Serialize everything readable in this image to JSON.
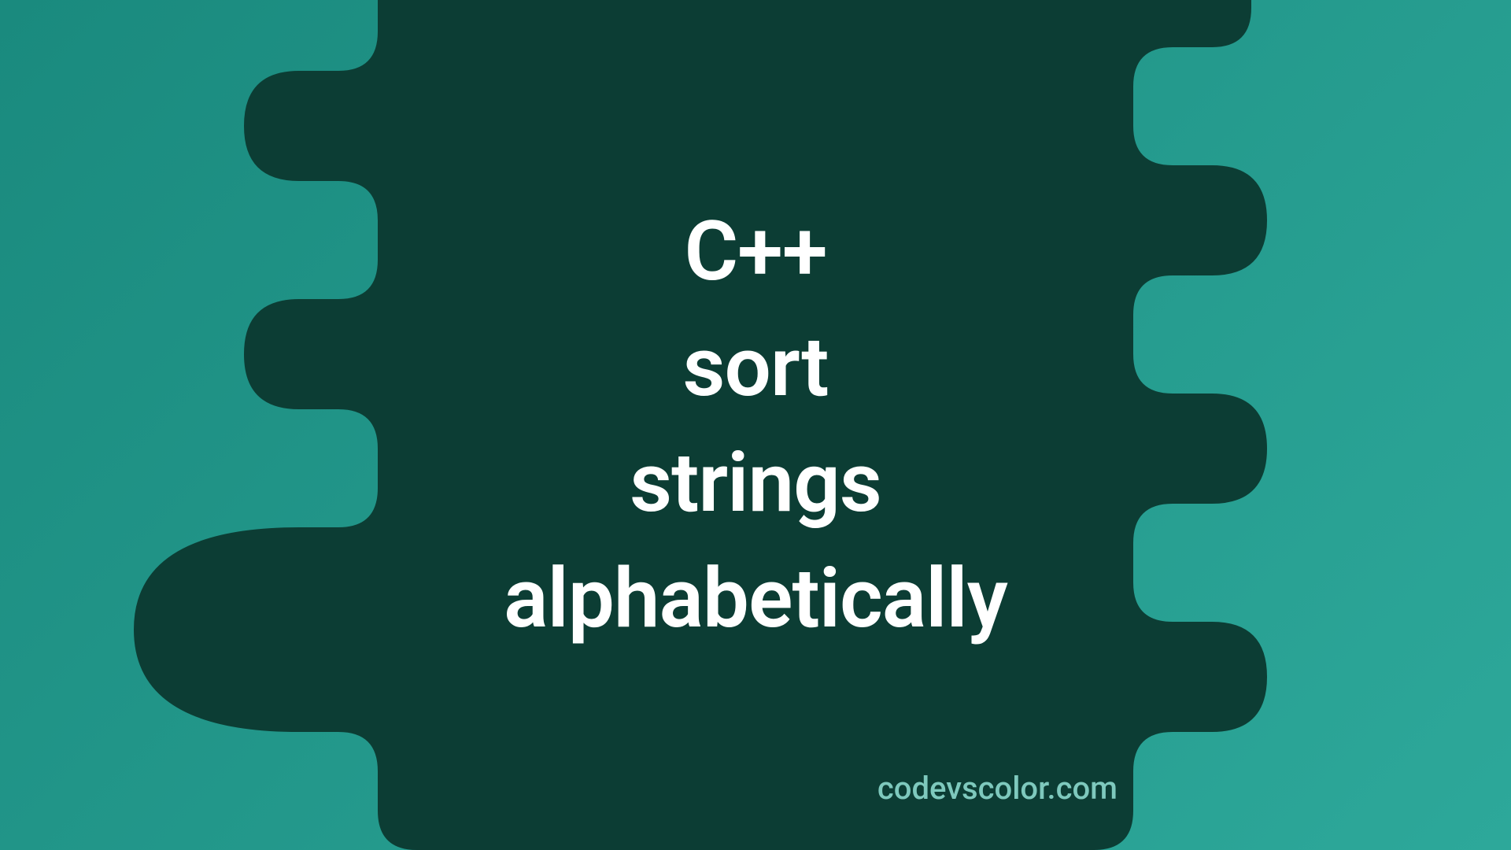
{
  "title": {
    "line1": "C++",
    "line2": "sort",
    "line3": "strings",
    "line4": "alphabetically"
  },
  "watermark": "codevscolor.com",
  "colors": {
    "background_start": "#1a8a7e",
    "background_end": "#2da89a",
    "blob": "#0c3d34",
    "title_text": "#ffffff",
    "watermark_text": "#7ec9bd"
  }
}
